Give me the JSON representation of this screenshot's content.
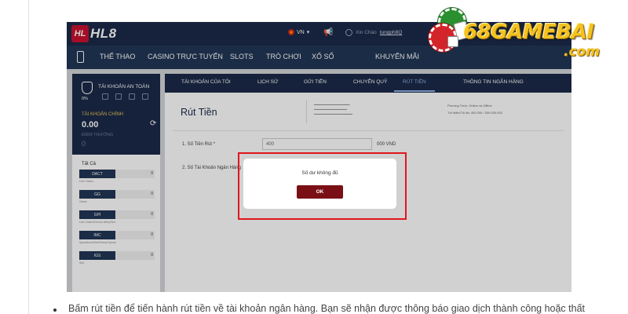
{
  "site": {
    "logo_mark": "HL",
    "logo_text": "HL8",
    "language": "VN",
    "greeting": "Xin Chào",
    "username": "tungph8Q"
  },
  "nav": {
    "items": [
      "THỂ THAO",
      "CASINO TRỰC TUYẾN",
      "SLOTS",
      "TRÒ CHƠI",
      "XỔ SỐ",
      "KHUYẾN MÃI"
    ]
  },
  "sidebar": {
    "title": "TÀI KHOẢN AN TOÀN",
    "percent": "0%",
    "main_account_label": "TÀI KHOẢN CHÍNH",
    "main_balance": "0.00",
    "promo_label": "ĐIỂM THƯỞNG",
    "promo_value": "0",
    "all_label": "Tất Cả",
    "wallets": [
      {
        "code": "DACT",
        "value": "0",
        "sub": "Live Casino"
      },
      {
        "code": "GG",
        "value": "0",
        "sub": "Game"
      },
      {
        "code": "GPI",
        "value": "0",
        "sub": "Live Casino/Keno/Lottery/Slot"
      },
      {
        "code": "IMC",
        "value": "0",
        "sub": "Sportsbook/Slot/Virtual Sports"
      },
      {
        "code": "IGS",
        "value": "0",
        "sub": "Slot"
      }
    ]
  },
  "tabs": [
    "TÀI KHOẢN CỦA TÔI",
    "LỊCH SỬ",
    "GỬI TIỀN",
    "CHUYỂN QUỸ",
    "RÚT TIỀN",
    "THÔNG TIN NGÂN HÀNG"
  ],
  "withdraw": {
    "title": "Rút Tiền",
    "amount_label": "1. Số Tiền Rút *",
    "amount_value": "400",
    "currency": "000 VND",
    "bank_label": "2. Số Tài Khoản Ngân Hàng",
    "method_label": "Phương Thức: Online và Offline",
    "limit_label": "Tối thiểu/Tối đa: 400.000 / 300.000.000"
  },
  "modal": {
    "message": "Số dư không đủ",
    "ok_label": "OK"
  },
  "watermark": {
    "brand": "68GAMEBAI",
    "domain": ".com"
  },
  "caption": "Bấm rút tiền để tiến hành rút tiền về tài khoản ngân hàng. Bạn sẽ nhận được thông báo giao dịch thành công hoặc thất"
}
